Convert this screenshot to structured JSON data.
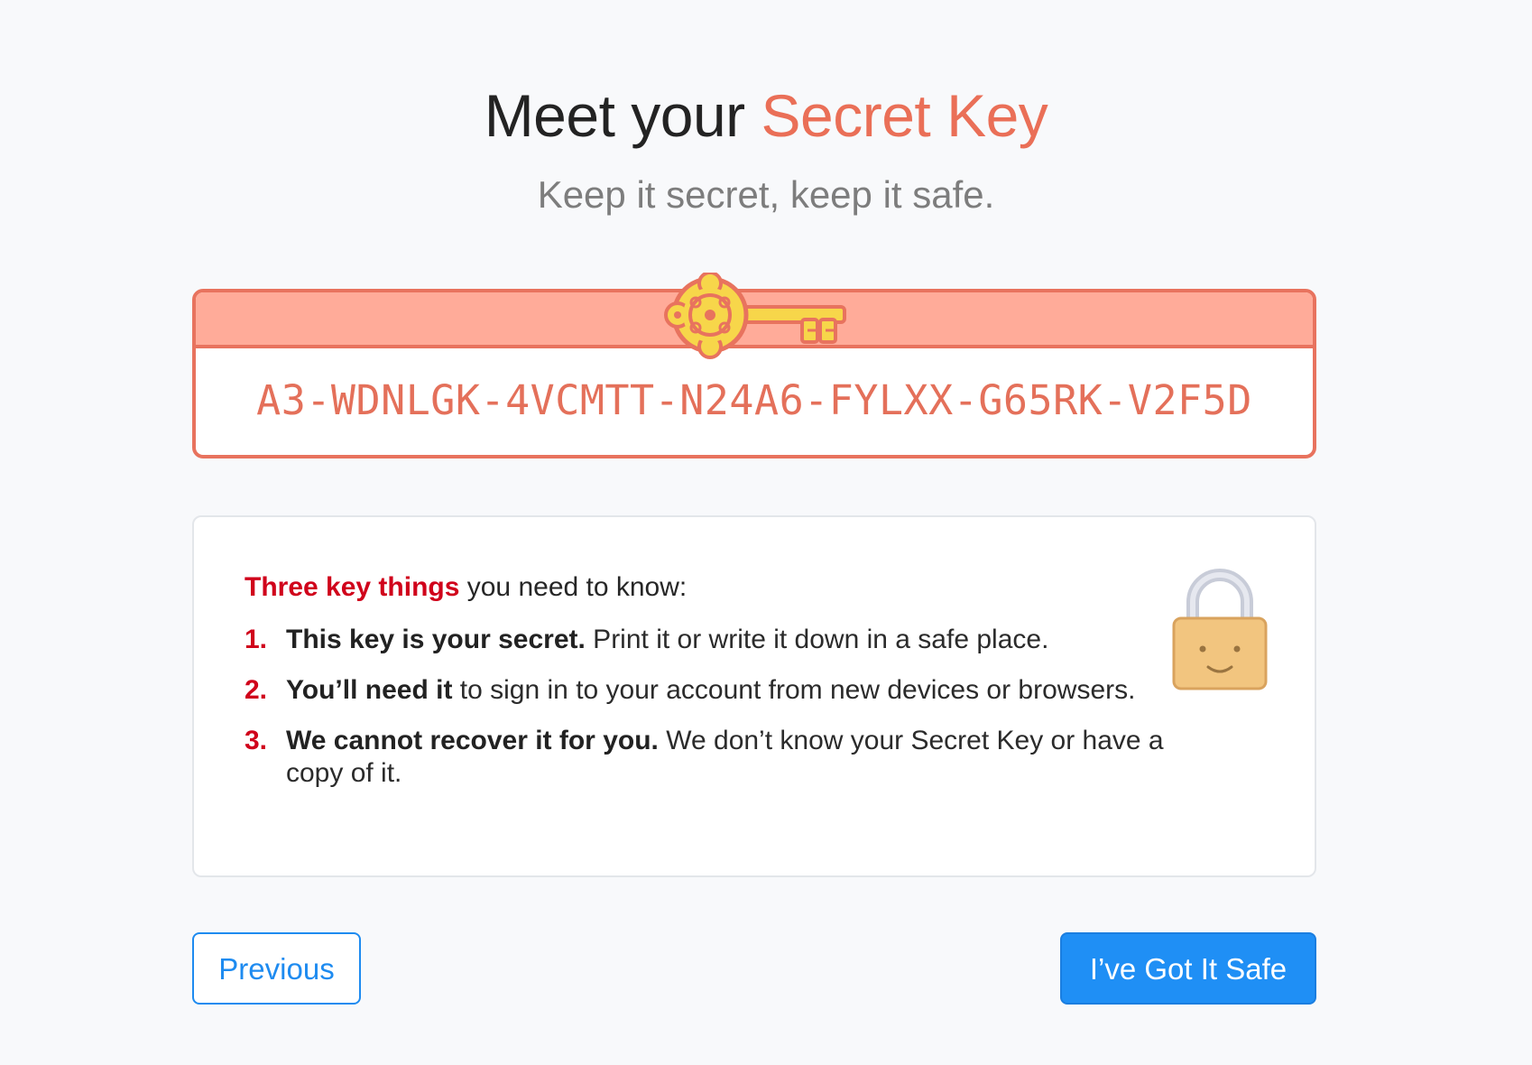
{
  "header": {
    "title_prefix": "Meet your ",
    "title_accent": "Secret Key",
    "subtitle": "Keep it secret, keep it safe."
  },
  "key_card": {
    "icon": "key-icon",
    "secret_key": "A3-WDNLGK-4VCMTT-N24A6-FYLXX-G65RK-V2F5D"
  },
  "info": {
    "intro_highlight": "Three key things",
    "intro_rest": " you need to know:",
    "icon": "padlock-icon",
    "items": [
      {
        "num": "1.",
        "bold": "This key is your secret.",
        "text": " Print it or write it down in a safe place."
      },
      {
        "num": "2.",
        "bold": "You’ll need it",
        "text": " to sign in to your account from new devices or browsers."
      },
      {
        "num": "3.",
        "bold": "We cannot recover it for you.",
        "text": " We don’t know your Secret Key or have a copy of it."
      }
    ]
  },
  "buttons": {
    "previous_label": "Previous",
    "confirm_label": "I’ve Got It Safe"
  },
  "colors": {
    "accent": "#ea6f57",
    "key_header": "#ffab99",
    "highlight_red": "#d0021b",
    "primary_blue": "#1f8ff5",
    "key_gold": "#f7d64a",
    "lock_body": "#f2c57f"
  }
}
